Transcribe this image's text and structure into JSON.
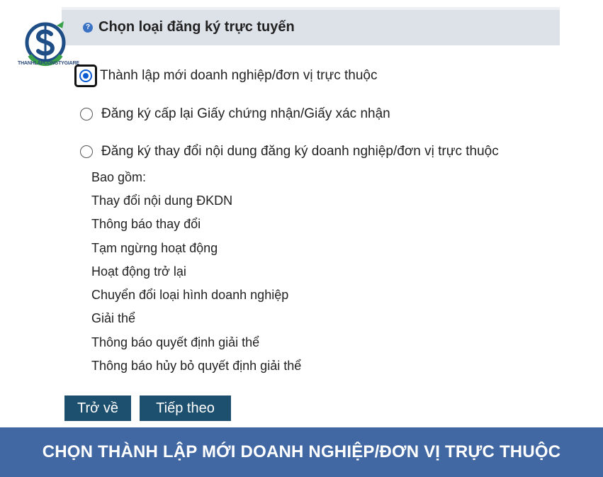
{
  "logo": {
    "text": "THANHLAPCONGTYGIARE"
  },
  "panel": {
    "header_icon": "info-icon",
    "title": "Chọn loại đăng ký trực tuyến"
  },
  "options": [
    {
      "label": "Thành lập mới doanh nghiệp/đơn vị trực thuộc",
      "selected": true
    },
    {
      "label": "Đăng ký cấp lại Giấy chứng nhận/Giấy xác nhận",
      "selected": false
    },
    {
      "label": "Đăng ký thay đổi nội dung đăng ký doanh nghiệp/đơn vị trực thuộc",
      "selected": false
    }
  ],
  "includes_label": "Bao gồm:",
  "includes": [
    "Thay đổi nội dung ĐKDN",
    "Thông báo thay đổi",
    "Tạm ngừng hoạt động",
    "Hoạt động trở lại",
    "Chuyển đổi loại hình doanh nghiệp",
    "Giải thể",
    "Thông báo quyết định giải thể",
    "Thông báo hủy bỏ quyết định giải thể"
  ],
  "buttons": {
    "back": "Trở về",
    "next": "Tiếp theo"
  },
  "footer": {
    "caption": "CHỌN THÀNH LẬP MỚI DOANH NGHIỆP/ĐƠN VỊ TRỰC THUỘC"
  },
  "colors": {
    "button_bg": "#1d4f6e",
    "footer_bg": "#4268a3",
    "radio_selected": "#0b5bd3"
  }
}
